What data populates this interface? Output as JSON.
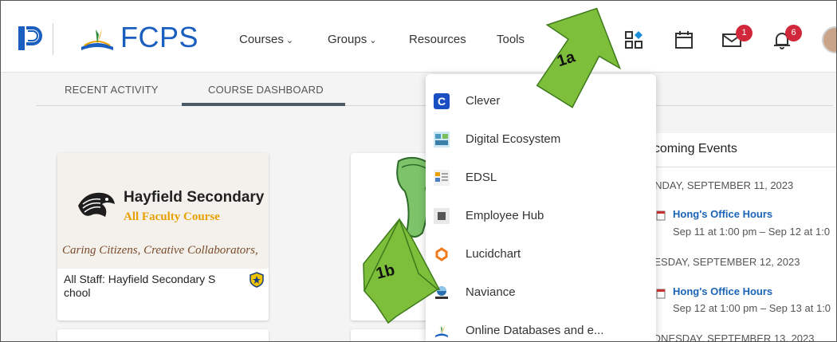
{
  "header": {
    "brand": "FCPS",
    "nav": [
      {
        "label": "Courses",
        "has_menu": true
      },
      {
        "label": "Groups",
        "has_menu": true
      },
      {
        "label": "Resources",
        "has_menu": false
      },
      {
        "label": "Tools",
        "has_menu": false
      }
    ],
    "messages_count": "1",
    "notifications_count": "6",
    "icons": [
      "apps-icon",
      "calendar-icon",
      "mail-icon",
      "bell-icon",
      "avatar"
    ]
  },
  "tabs": [
    {
      "label": "RECENT ACTIVITY",
      "active": false
    },
    {
      "label": "COURSE DASHBOARD",
      "active": true
    }
  ],
  "courses": [
    {
      "banner_title": "Hayfield Secondary",
      "banner_subtitle": "All Faculty Course",
      "banner_motto": "Caring Citizens, Creative Collaborators,",
      "name": "All Staff: Hayfield Secondary S chool"
    }
  ],
  "apps_menu": [
    {
      "label": "Clever",
      "icon": "clever-icon"
    },
    {
      "label": "Digital Ecosystem",
      "icon": "digital-ecosystem-icon"
    },
    {
      "label": "EDSL",
      "icon": "edsl-icon"
    },
    {
      "label": "Employee Hub",
      "icon": "employee-hub-icon"
    },
    {
      "label": "Lucidchart",
      "icon": "lucidchart-icon"
    },
    {
      "label": "Naviance",
      "icon": "naviance-icon"
    },
    {
      "label": "Online Databases and e...",
      "icon": "fcps-icon"
    }
  ],
  "events": {
    "title": "pcoming Events",
    "days": [
      {
        "header": "ONDAY, SEPTEMBER 11, 2023",
        "title": "Hong's Office Hours",
        "time": "Sep 11 at 1:00 pm – Sep 12 at 1:0"
      },
      {
        "header": "UESDAY, SEPTEMBER 12, 2023",
        "title": "Hong's Office Hours",
        "time": "Sep 12 at 1:00 pm – Sep 13 at 1:0"
      },
      {
        "header": "EDNESDAY, SEPTEMBER 13, 2023"
      }
    ]
  },
  "annotations": {
    "arrow_1a": "1a",
    "arrow_1b": "1b",
    "color": "#7dbf3a"
  },
  "colors": {
    "brand_blue": "#1a5fbf",
    "badge_red": "#d0283a",
    "link_blue": "#1a64b8"
  }
}
